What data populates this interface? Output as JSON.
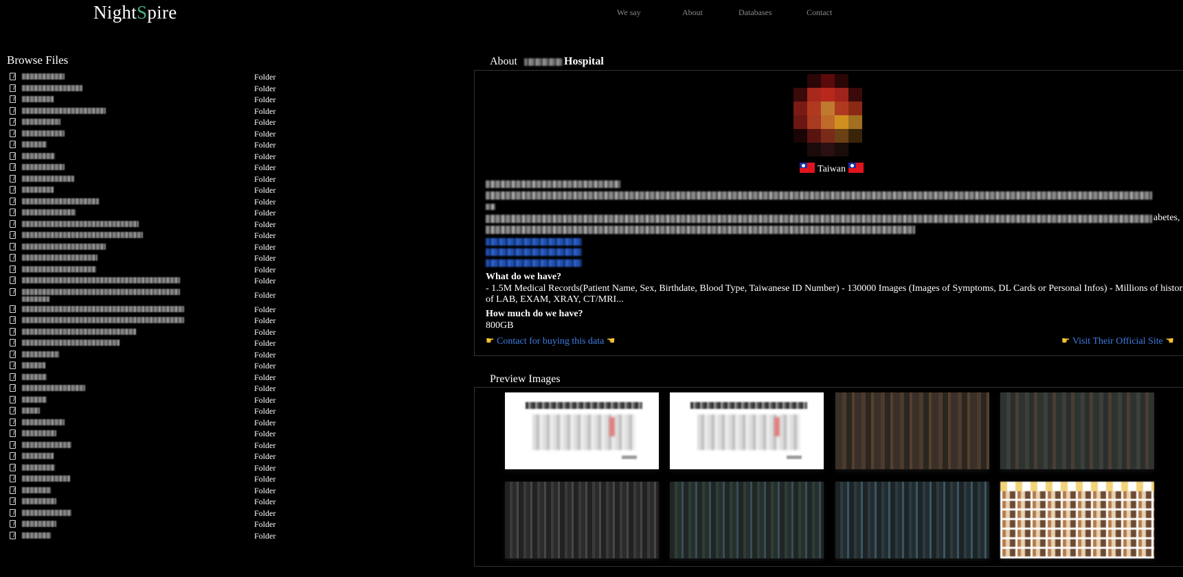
{
  "site": {
    "logo_part1": "Night",
    "logo_s": "S",
    "logo_part2": "pire"
  },
  "nav": {
    "items": [
      "We say",
      "About",
      "Databases",
      "Contact"
    ]
  },
  "browse": {
    "title": "Browse Files",
    "type_label": "Folder",
    "row_count": 41
  },
  "about": {
    "heading_prefix": "About",
    "heading_suffix": "Hospital",
    "country": "Taiwan",
    "what_label": "What do we have?",
    "what_line1": "- 1.5M Medical Records(Patient Name, Sex, Birthdate, Blood Type, Taiwanese ID Number) - 130000 Images (Images of Symptoms, DL Cards or Personal Infos) - Millions of histories",
    "what_line2": "of LAB, EXAM, XRAY, CT/MRI...",
    "how_much_label": "How much do we have?",
    "size": "800GB",
    "contact_link": "Contact for buying this data",
    "visit_link": "Visit Their Official Site",
    "partial_word": "abetes,"
  },
  "preview": {
    "title": "Preview Images"
  },
  "colors": {
    "background": "#000000",
    "accent_green": "#3fb27f",
    "link_blue": "#3f7de4",
    "nav_gray": "#8a8a8a"
  },
  "icons": {
    "file": "file-icon",
    "flag": "taiwan-flag-icon",
    "pointer": "pointing-hand-icon"
  }
}
